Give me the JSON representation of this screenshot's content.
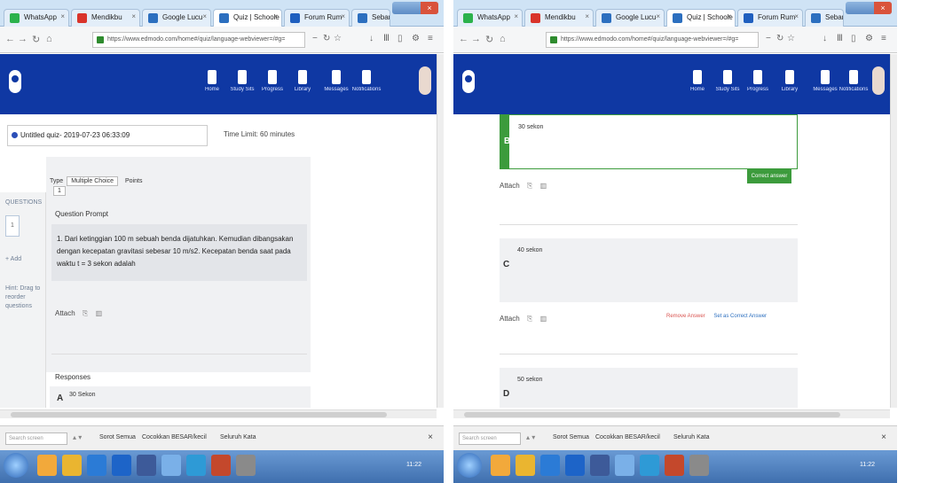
{
  "left": {
    "tabs": [
      {
        "label": "WhatsApp",
        "icon_color": "#2bb24c",
        "active": false
      },
      {
        "label": "Mendikbu",
        "icon_color": "#d9342b",
        "active": false
      },
      {
        "label": "Google Lucu",
        "icon_color": "#2c6fbf",
        "active": false
      },
      {
        "label": "Quiz | Schoole",
        "icon_color": "#2c6fbf",
        "active": true
      },
      {
        "label": "Forum Rum",
        "icon_color": "#1f5fbf",
        "active": false
      },
      {
        "label": "Sebang lalu",
        "icon_color": "#2c6fbf",
        "active": false
      }
    ],
    "url": "https://www.edmodo.com/home#/quiz/language-webviewer=/#g=",
    "nav": [
      {
        "label": "Home",
        "icon": "home-icon"
      },
      {
        "label": "Study Sits",
        "icon": "study-icon"
      },
      {
        "label": "Progress",
        "icon": "progress-icon"
      },
      {
        "label": "Library",
        "icon": "library-icon"
      },
      {
        "label": "Messages",
        "icon": "messages-icon"
      },
      {
        "label": "Notifications",
        "icon": "bell-icon"
      }
    ],
    "quiz_title": "Untitled quiz- 2019-07-23 06:33:09",
    "time_limit": "Time Limit:  60  minutes",
    "question_type_label": "Type",
    "question_type_value": "Multiple Choice",
    "points_label": "Points",
    "points_value": "1",
    "sidebar_title": "QUESTIONS",
    "sidebar_item": "1",
    "sidebar_add": "+ Add",
    "sidebar_help": "Hint: Drag to reorder questions",
    "prompt_label": "Question Prompt",
    "prompt_text": "1. Dari ketinggian 100 m sebuah benda dijatuhkan. Kemudian dibangsakan dengan kecepatan gravitasi sebesar 10 m/s2. Kecepatan benda saat pada waktu t = 3 sekon adalah",
    "attach_label": "Attach",
    "responses_label": "Responses",
    "response_badge": "A",
    "response_text": "30 Sekon"
  },
  "right": {
    "answers": [
      {
        "badge": "B",
        "text": "30 sekon",
        "correct": true
      },
      {
        "badge": "C",
        "text": "40 sekon",
        "correct": false
      },
      {
        "badge": "D",
        "text": "50 sekon",
        "correct": false
      }
    ],
    "correct_button": "Correct answer",
    "attach_label": "Attach",
    "remove_link": "Remove Answer",
    "set_correct_link": "Set as Correct Answer"
  },
  "findbar": {
    "placeholder": "Search screen",
    "options": [
      "Sorot Semua",
      "Cocokkan BESAR/kecil",
      "Seluruh Kata"
    ]
  },
  "taskbar": {
    "apps": [
      "#f2a93b",
      "#eab530",
      "#2b7bd6",
      "#1d64c8",
      "#3d5a99",
      "#7ab0e8",
      "#2e9ad6",
      "#c4482c",
      "#8a8a8a"
    ],
    "tray_time": "11:22"
  }
}
